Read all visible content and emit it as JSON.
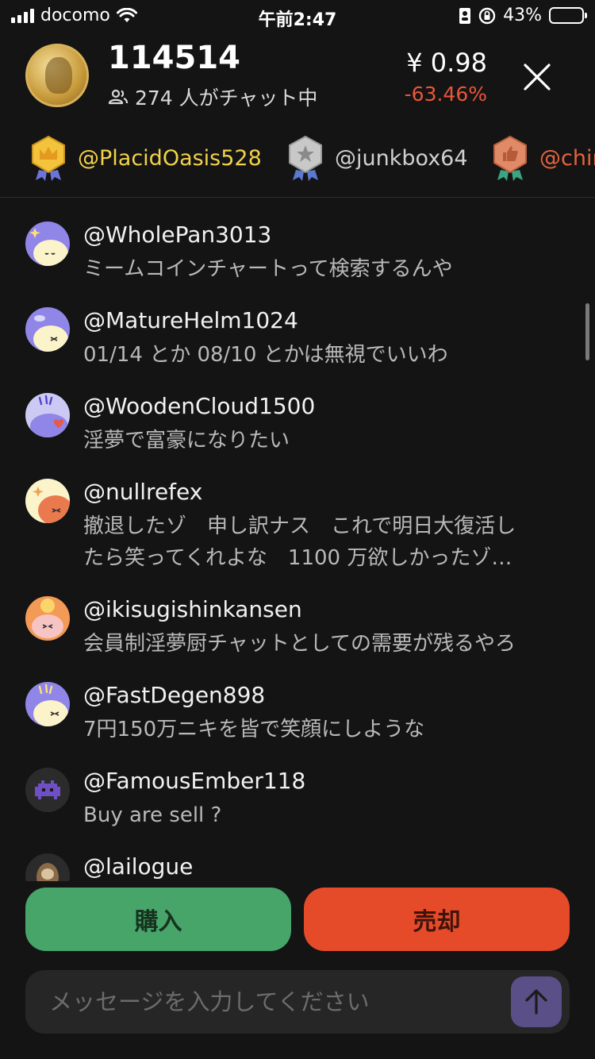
{
  "status_bar": {
    "carrier": "docomo",
    "time": "午前2:47",
    "battery": "43%",
    "battery_level": 0.43
  },
  "header": {
    "title": "114514",
    "members": "274 人がチャット中",
    "price": "¥ 0.98",
    "change": "-63.46%",
    "change_color": "#e9573b"
  },
  "holders": [
    {
      "name": "@PlacidOasis528",
      "color": "#f1d24a",
      "badge": "gold-crown-badge"
    },
    {
      "name": "@junkbox64",
      "color": "#d0d0d0",
      "badge": "silver-star-badge"
    },
    {
      "name": "@chir",
      "color": "#e5633f",
      "badge": "bronze-thumbs-up-badge"
    }
  ],
  "messages": [
    {
      "user": "@WholePan3013",
      "text": "ミームコインチャートって検索するんや"
    },
    {
      "user": "@MatureHelm1024",
      "text": "01/14 とか 08/10 とかは無視でいいわ"
    },
    {
      "user": "@WoodenCloud1500",
      "text": "淫夢で富豪になりたい"
    },
    {
      "user": "@nullrefex",
      "text": "撤退したゾ　申し訳ナス　これで明日大復活し",
      "text2": "たら笑ってくれよな　1100 万欲しかったゾ…"
    },
    {
      "user": "@ikisugishinkansen",
      "text": "会員制淫夢厨チャットとしての需要が残るやろ"
    },
    {
      "user": "@FastDegen898",
      "text": "7円150万ニキを皆で笑顔にしような"
    },
    {
      "user": "@FamousEmber118",
      "text": "Buy are sell ?"
    },
    {
      "user": "@lailogue",
      "text": ""
    }
  ],
  "actions": {
    "buy_label": "購入",
    "sell_label": "売却",
    "buy_color": "#47a56a",
    "sell_color": "#e54a29"
  },
  "composer": {
    "placeholder": "メッセージを入力してください"
  }
}
